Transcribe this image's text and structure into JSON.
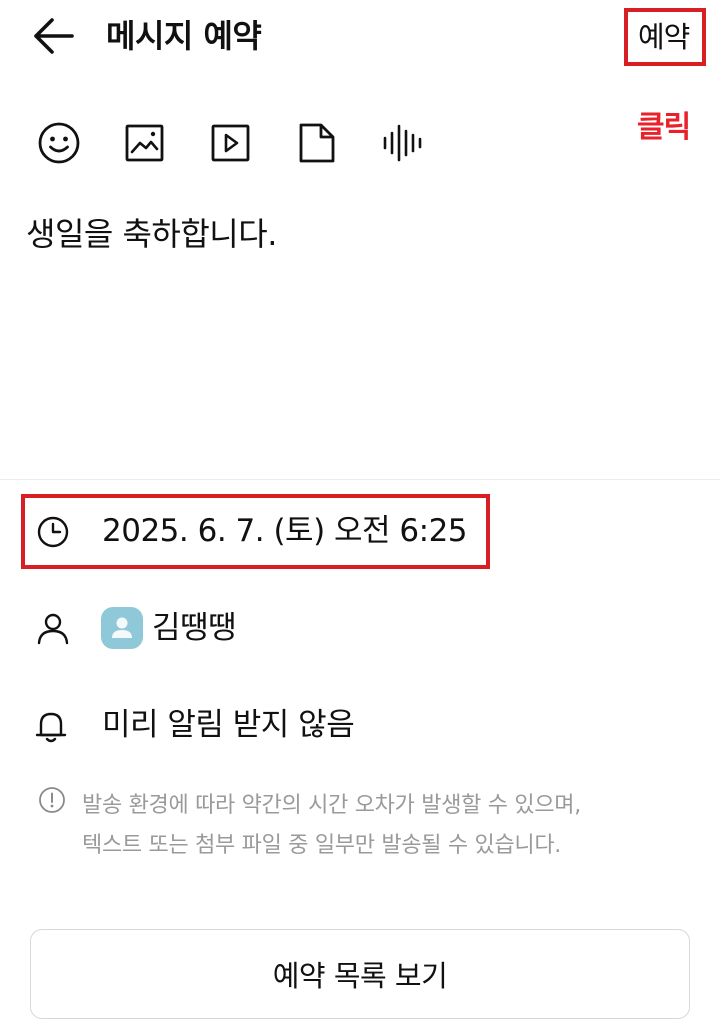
{
  "header": {
    "title": "메시지 예약",
    "reserve_label": "예약"
  },
  "annotation": {
    "click_label": "클릭",
    "highlight_color": "#d81f26"
  },
  "toolbar": {
    "icons": [
      "emoji-icon",
      "image-icon",
      "video-icon",
      "file-icon",
      "voice-icon"
    ]
  },
  "message": {
    "text": "생일을 축하합니다."
  },
  "schedule": {
    "datetime": "2025. 6. 7. (토) 오전 6:25"
  },
  "recipient": {
    "name": "김땡땡"
  },
  "reminder": {
    "label": "미리 알림 받지 않음"
  },
  "notice": {
    "line1": "발송 환경에 따라 약간의 시간 오차가 발생할 수 있으며,",
    "line2": "텍스트 또는 첨부 파일 중 일부만 발송될 수 있습니다."
  },
  "footer": {
    "list_button_label": "예약 목록 보기"
  }
}
